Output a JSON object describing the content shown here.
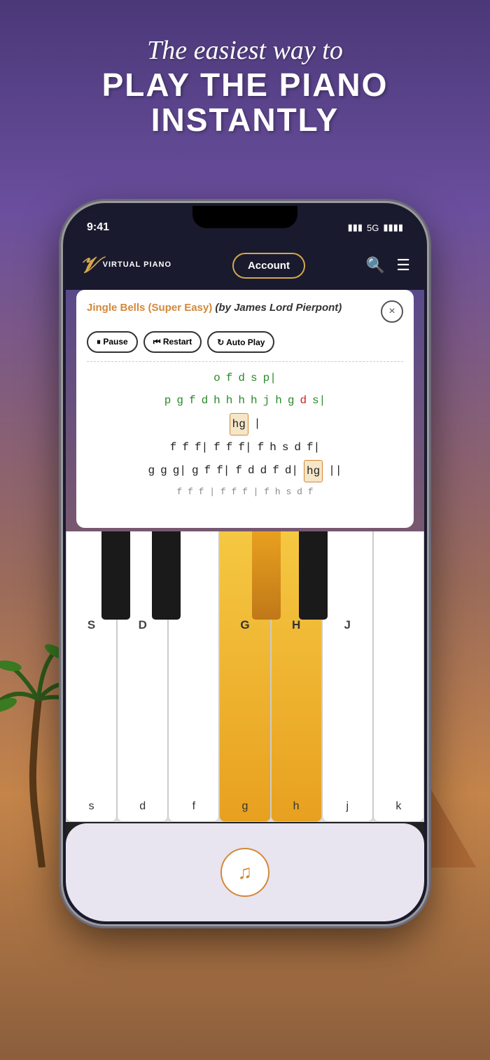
{
  "header": {
    "tagline_italic": "The easiest way to",
    "tagline_bold_1": "PLAY THE PIANO",
    "tagline_bold_2": "INSTANTLY"
  },
  "status_bar": {
    "time": "9:41",
    "signal": "5G",
    "battery": "▮▮▮"
  },
  "app_nav": {
    "logo_text": "VIRTUAL\nPIANO",
    "account_label": "Account",
    "search_icon": "search",
    "menu_icon": "menu"
  },
  "song": {
    "title": "Jingle Bells (Super Easy)",
    "author": "(by James Lord Pierpont)",
    "close_label": "×"
  },
  "controls": {
    "pause_label": "⏸ Pause",
    "restart_label": "⏮ Restart",
    "autoplay_label": "↻ Auto Play"
  },
  "notes": {
    "line1": [
      "o",
      "f",
      "d",
      "s",
      "p|"
    ],
    "line2": [
      "p",
      "g",
      "f",
      "d",
      "h",
      "h",
      "h",
      "h",
      "j",
      "h",
      "g",
      "d*",
      "s|"
    ],
    "line3_highlight": "[hg]|",
    "line4": [
      "f",
      "f",
      "f|",
      "f",
      "f",
      "f|",
      "f",
      "h",
      "s",
      "d",
      "f|"
    ],
    "line5": [
      "g",
      "g",
      "g|",
      "g",
      "f",
      "f|",
      "f",
      "d",
      "d",
      "f",
      "d|",
      "[hg]||"
    ],
    "line6_partial": "f  f  f | f  f  f | f  h  s  d  f"
  },
  "piano_keys": {
    "white_keys": [
      "s",
      "d",
      "f",
      "g",
      "h",
      "j",
      "k"
    ],
    "white_keys_upper": [
      "S",
      "D",
      "",
      "G",
      "H",
      "J",
      ""
    ],
    "black_keys": [
      "",
      "",
      "",
      "",
      ""
    ],
    "highlighted_keys": [
      "g",
      "h",
      "G",
      "H"
    ]
  },
  "bottom": {
    "music_icon": "♫"
  },
  "colors": {
    "accent_orange": "#d4883a",
    "note_green": "#2a8a2a",
    "note_red": "#cc2222",
    "bg_dark": "#1a1a2e",
    "bg_gradient_top": "#5a4a8a",
    "bg_gradient_bottom": "#8b5e3c"
  }
}
